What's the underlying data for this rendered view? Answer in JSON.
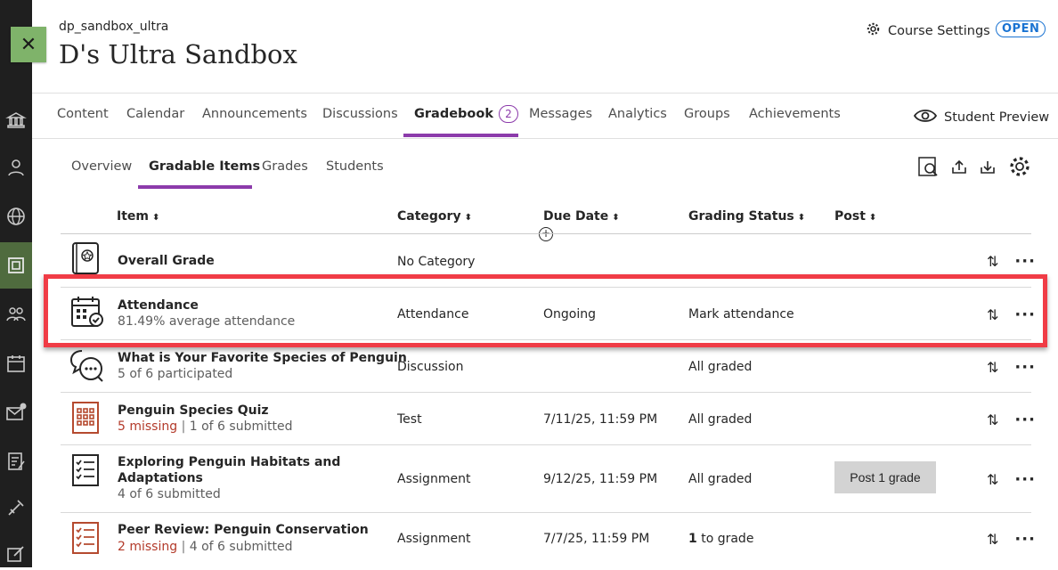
{
  "course": {
    "id": "dp_sandbox_ultra",
    "title": "D's Ultra Sandbox",
    "settings_label": "Course Settings",
    "status_badge": "OPEN"
  },
  "top_nav": {
    "items": [
      "Content",
      "Calendar",
      "Announcements",
      "Discussions",
      "Gradebook",
      "Messages",
      "Analytics",
      "Groups",
      "Achievements"
    ],
    "active": "Gradebook",
    "gradebook_count": "2",
    "student_preview": "Student Preview"
  },
  "sub_nav": {
    "items": [
      "Overview",
      "Gradable Items",
      "Grades",
      "Students"
    ],
    "active": "Gradable Items"
  },
  "columns": [
    "Item",
    "Category",
    "Due Date",
    "Grading Status",
    "Post"
  ],
  "rows": [
    {
      "title": "Overall Grade",
      "category": "No Category",
      "due": "",
      "status": "",
      "icon": "gradebook-book-icon"
    },
    {
      "title": "Attendance",
      "subtitle": "81.49% average attendance",
      "category": "Attendance",
      "due": "Ongoing",
      "status": "Mark attendance",
      "icon": "attendance-calendar-icon"
    },
    {
      "title": "What is Your Favorite Species of Penguin",
      "subtitle": "5 of 6 participated",
      "category": "Discussion",
      "due": "",
      "status": "All graded",
      "icon": "discussion-icon"
    },
    {
      "title": "Penguin Species Quiz",
      "missing": "5 missing",
      "submitted": "1 of 6 submitted",
      "category": "Test",
      "due": "7/11/25, 11:59 PM",
      "status": "All graded",
      "icon": "test-icon"
    },
    {
      "title_line1": "Exploring Penguin Habitats and",
      "title_line2": "Adaptations",
      "subtitle": "4 of 6 submitted",
      "category": "Assignment",
      "due": "9/12/25, 11:59 PM",
      "status": "All graded",
      "post_button": "Post 1 grade",
      "icon": "assignment-icon"
    },
    {
      "title": "Peer Review: Penguin Conservation",
      "missing": "2 missing",
      "submitted": "4 of 6 submitted",
      "category": "Assignment",
      "due": "7/7/25, 11:59 PM",
      "status_count": "1",
      "status_text": " to grade",
      "icon": "assignment-icon"
    }
  ],
  "separator": "|",
  "close_glyph": "✕",
  "colors": {
    "accent": "#8c3bab",
    "highlight": "#f03c46",
    "open_badge": "#1a73d2",
    "missing": "#b33a2a"
  }
}
